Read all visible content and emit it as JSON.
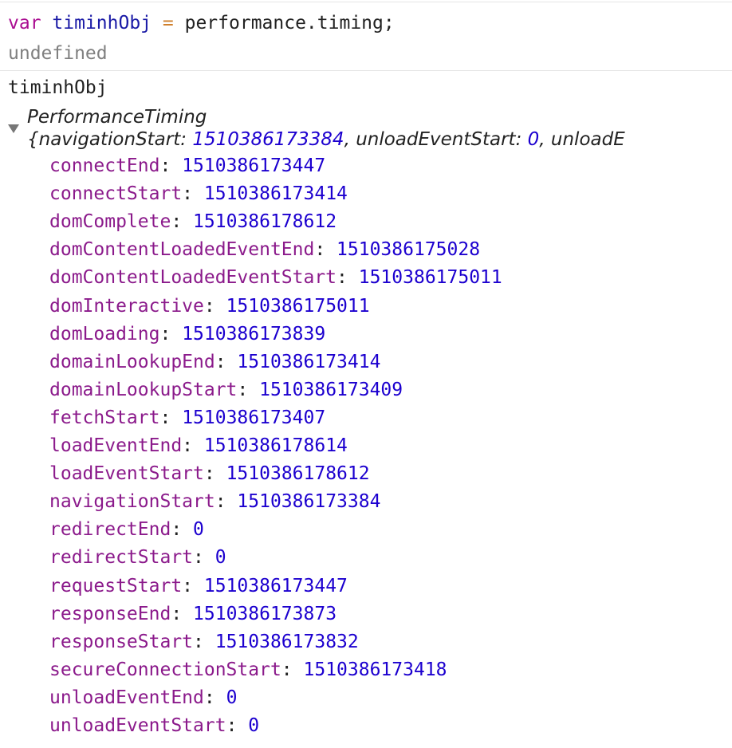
{
  "console": {
    "input_line": {
      "keyword": "var",
      "variable": "timinhObj",
      "operator": "=",
      "expression": "performance.timing;"
    },
    "result_line": "undefined",
    "second_input": "timinhObj",
    "object_class": "PerformanceTiming",
    "preview": {
      "open": "{",
      "items": [
        {
          "key": "navigationStart",
          "value": "1510386173384"
        },
        {
          "key": "unloadEventStart",
          "value": "0"
        },
        {
          "key": "unloadE",
          "value": ""
        }
      ]
    },
    "properties": [
      {
        "key": "connectEnd",
        "value": "1510386173447"
      },
      {
        "key": "connectStart",
        "value": "1510386173414"
      },
      {
        "key": "domComplete",
        "value": "1510386178612"
      },
      {
        "key": "domContentLoadedEventEnd",
        "value": "1510386175028"
      },
      {
        "key": "domContentLoadedEventStart",
        "value": "1510386175011"
      },
      {
        "key": "domInteractive",
        "value": "1510386175011"
      },
      {
        "key": "domLoading",
        "value": "1510386173839"
      },
      {
        "key": "domainLookupEnd",
        "value": "1510386173414"
      },
      {
        "key": "domainLookupStart",
        "value": "1510386173409"
      },
      {
        "key": "fetchStart",
        "value": "1510386173407"
      },
      {
        "key": "loadEventEnd",
        "value": "1510386178614"
      },
      {
        "key": "loadEventStart",
        "value": "1510386178612"
      },
      {
        "key": "navigationStart",
        "value": "1510386173384"
      },
      {
        "key": "redirectEnd",
        "value": "0"
      },
      {
        "key": "redirectStart",
        "value": "0"
      },
      {
        "key": "requestStart",
        "value": "1510386173447"
      },
      {
        "key": "responseEnd",
        "value": "1510386173873"
      },
      {
        "key": "responseStart",
        "value": "1510386173832"
      },
      {
        "key": "secureConnectionStart",
        "value": "1510386173418"
      },
      {
        "key": "unloadEventEnd",
        "value": "0"
      },
      {
        "key": "unloadEventStart",
        "value": "0"
      }
    ],
    "colors": {
      "keyword": "#aa0d91",
      "identifier": "#1a1aa6",
      "property_key": "#8b1a8b",
      "number": "#1c00cf",
      "result": "#808080"
    }
  }
}
